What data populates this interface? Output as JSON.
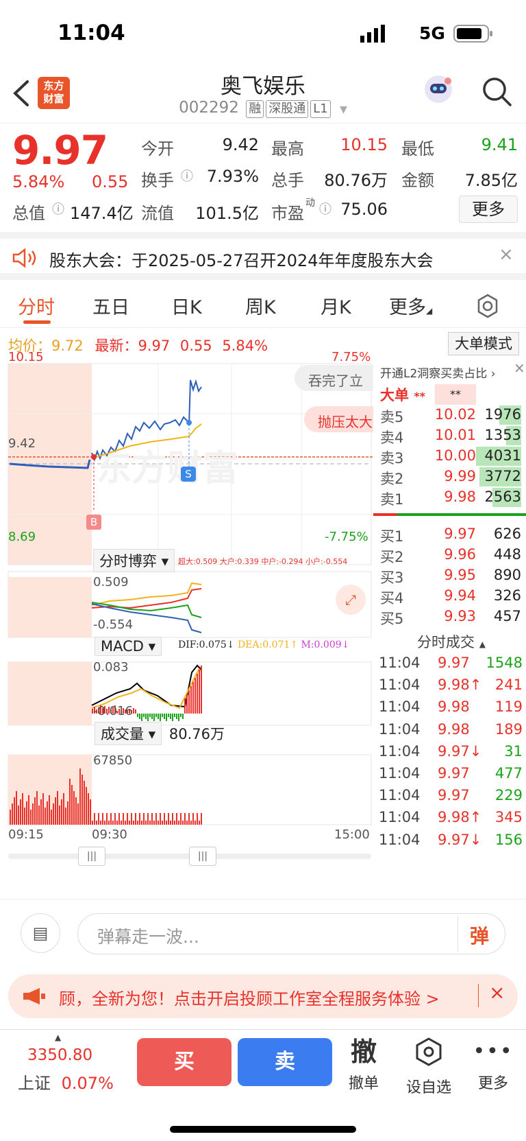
{
  "status": {
    "time": "11:04",
    "network": "5G"
  },
  "nav": {
    "name": "奥飞娱乐",
    "code": "002292",
    "tags": [
      "融",
      "深股通",
      "L1"
    ],
    "logo_text": "东方财富"
  },
  "quote": {
    "price": "9.97",
    "change_pct": "5.84%",
    "change": "0.55",
    "fields": [
      {
        "label": "今开",
        "value": "9.42"
      },
      {
        "label": "最高",
        "value": "10.15"
      },
      {
        "label": "最低",
        "value": "9.41"
      },
      {
        "label": "换手",
        "value": "7.93%"
      },
      {
        "label": "总手",
        "value": "80.76万"
      },
      {
        "label": "金额",
        "value": "7.85亿"
      },
      {
        "label": "总值",
        "value": "147.4亿"
      },
      {
        "label": "流值",
        "value": "101.5亿"
      },
      {
        "label": "市盈",
        "value": "75.06"
      }
    ],
    "pe_sup": "动",
    "more_label": "更多"
  },
  "notice": {
    "text": "股东大会：于2025-05-27召开2024年年度股东大会"
  },
  "tabs": [
    "分时",
    "五日",
    "日K",
    "周K",
    "月K",
    "更多"
  ],
  "info": {
    "avg_label": "均价：",
    "avg": "9.72",
    "latest_label": "最新：",
    "latest": "9.97",
    "chg": "0.55",
    "pct": "5.84%",
    "mode_label": "大单模式"
  },
  "chart": {
    "y_top": "10.15",
    "y_bottom": "8.69",
    "pct_top": "7.75%",
    "pct_bottom": "-7.75%",
    "open_mark": "9.42",
    "buy_mark": "B",
    "sell_mark": "S",
    "bubble1": "吞完了立",
    "bubble2": "抛压太大",
    "watermark": "东方财富",
    "x_start": "09:15",
    "x_mid": "09:30",
    "x_end": "15:00"
  },
  "game": {
    "label": "分时博弈",
    "values": "超大:0.509 大户:0.339 中户:-0.294 小户:-0.554",
    "top": "0.509",
    "bottom": "-0.554"
  },
  "macd": {
    "label": "MACD",
    "dif": "DIF:0.075↓",
    "dea": "DEA:0.071↑",
    "m": "M:0.009↓",
    "top": "0.083",
    "bottom": "-0.016"
  },
  "volume": {
    "label": "成交量",
    "total": "80.76万",
    "max": "67850"
  },
  "book": {
    "banner": "开通L2洞察买卖占比",
    "big_label": "大单",
    "big_mask1": "**",
    "big_mask2": "**",
    "asks": [
      {
        "label": "卖5",
        "price": "10.02",
        "vol": "1976",
        "share": 0.48
      },
      {
        "label": "卖4",
        "price": "10.01",
        "vol": "1353",
        "share": 0.33
      },
      {
        "label": "卖3",
        "price": "10.00",
        "vol": "4031",
        "share": 1.0
      },
      {
        "label": "卖2",
        "price": "9.99",
        "vol": "3772",
        "share": 0.93
      },
      {
        "label": "卖1",
        "price": "9.98",
        "vol": "2563",
        "share": 0.63
      }
    ],
    "bids": [
      {
        "label": "买1",
        "price": "9.97",
        "vol": "626"
      },
      {
        "label": "买2",
        "price": "9.96",
        "vol": "448"
      },
      {
        "label": "买3",
        "price": "9.95",
        "vol": "890"
      },
      {
        "label": "买4",
        "price": "9.94",
        "vol": "326"
      },
      {
        "label": "买5",
        "price": "9.93",
        "vol": "457"
      }
    ],
    "trades_title": "分时成交",
    "trades": [
      {
        "time": "11:04",
        "price": "9.97",
        "vol": "1548",
        "color": "green"
      },
      {
        "time": "11:04",
        "price": "9.98↑",
        "vol": "241",
        "color": "red"
      },
      {
        "time": "11:04",
        "price": "9.98",
        "vol": "119",
        "color": "red"
      },
      {
        "time": "11:04",
        "price": "9.98",
        "vol": "189",
        "color": "red"
      },
      {
        "time": "11:04",
        "price": "9.97↓",
        "vol": "31",
        "color": "green"
      },
      {
        "time": "11:04",
        "price": "9.97",
        "vol": "477",
        "color": "green"
      },
      {
        "time": "11:04",
        "price": "9.97",
        "vol": "229",
        "color": "green"
      },
      {
        "time": "11:04",
        "price": "9.98↑",
        "vol": "345",
        "color": "red"
      },
      {
        "time": "11:04",
        "price": "9.97↓",
        "vol": "156",
        "color": "green"
      }
    ]
  },
  "comment": {
    "placeholder": "弹幕走一波...",
    "send": "弹"
  },
  "promo": {
    "text": "顾，全新为您！点击开启投顾工作室全程服务体验 >"
  },
  "toolbar": {
    "index_value": "3350.80",
    "index_name": "上证",
    "index_pct": "0.07%",
    "buy": "买",
    "sell": "卖",
    "cancel_icon": "撤",
    "cancel": "撤单",
    "watch": "设自选",
    "more": "更多"
  },
  "colors": {
    "up": "#e8312a",
    "down": "#1aa31a",
    "accent": "#e8552a",
    "buy_btn": "#ee5a55",
    "sell_btn": "#3b7cf0"
  }
}
